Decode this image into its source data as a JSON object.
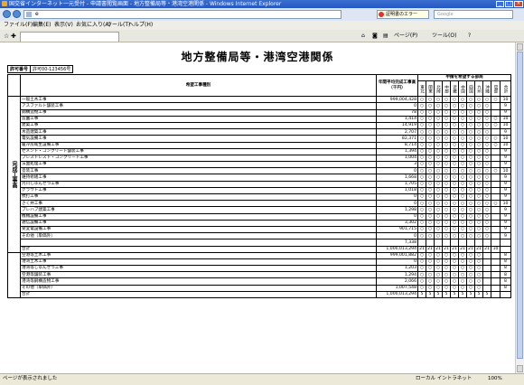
{
  "window": {
    "title": "国交省インターネット一元受付 - 申請書閲覧画面 - 地方整備局等・港湾空港関係 - Windows Internet Explorer"
  },
  "address_bar": {
    "url": "e",
    "error_label": "証明書のエラー",
    "search_placeholder": "Google"
  },
  "menu": [
    "ファイル(F)",
    "編集(E)",
    "表示(V)",
    "お気に入り(A)",
    "ツール(T)",
    "ヘルプ(H)"
  ],
  "tab": {
    "label": "",
    "toolbar_labels": [
      "ページ(P)",
      "ツール(O)"
    ]
  },
  "statusbar": {
    "text": "ページが表示されました",
    "zone": "ローカル イントラネット",
    "zoom": "100%"
  },
  "doc": {
    "title": "地方整備局等・港湾空港関係",
    "permit_label": "許可番号",
    "permit_value": "許可00-123456号",
    "col_work_type": "希望工事種別",
    "col_amount": "年間平均完成工事高（千円）",
    "col_regions_header": "申請を希望する部局",
    "regions": [
      "東北",
      "関東",
      "北陸",
      "中部",
      "近畿",
      "中国",
      "四国",
      "九州",
      "沖縄",
      "官邸",
      "合計"
    ],
    "group_completed": "完成工事高",
    "rows": [
      {
        "name": "一般土木工事",
        "amount": "999,004,428",
        "marks": "○○○○○○○○○○",
        "total": "10"
      },
      {
        "name": "アスファルト舗装工事",
        "amount": "0",
        "marks": "○○○○○○○○○",
        "total": "9"
      },
      {
        "name": "鋼構造物工事",
        "amount": "78",
        "marks": "○○○○○○○○○",
        "total": "9"
      },
      {
        "name": "造園工事",
        "amount": "1,414",
        "marks": "○○○○○○○○○○",
        "total": "10"
      },
      {
        "name": "建築工事",
        "amount": "14,919",
        "marks": "○○○○○○○○○○",
        "total": "10"
      },
      {
        "name": "木造建築工事",
        "amount": "2,707",
        "marks": "○○○○○○○○○",
        "total": "9"
      },
      {
        "name": "電気設備工事",
        "amount": "82,371",
        "marks": "○○○○○○○○○○",
        "total": "10"
      },
      {
        "name": "暖冷房衛生設備工事",
        "amount": "8,714",
        "marks": "○○○○○○○○○○",
        "total": "10"
      },
      {
        "name": "セメント・コンクリート舗装工事",
        "amount": "1,394",
        "marks": "○○○○○○○○○",
        "total": "9"
      },
      {
        "name": "プレストレスト・コンクリート工事",
        "amount": "1,004",
        "marks": "○○○○○○○○○",
        "total": "9"
      },
      {
        "name": "法面処理工事",
        "amount": "3",
        "marks": "○○○○○○○○○",
        "total": "9"
      },
      {
        "name": "塗装工事",
        "amount": "0",
        "marks": "○○○○○○○○○○",
        "total": "10"
      },
      {
        "name": "維持修繕工事",
        "amount": "1,668",
        "marks": "○○○○○○○○○",
        "total": "9"
      },
      {
        "name": "河川しゅんせつ工事",
        "amount": "1,705",
        "marks": "○○○○○○○○○",
        "total": "9"
      },
      {
        "name": "グラウト工事",
        "amount": "1,018",
        "marks": "○○○○○○○○○",
        "total": "9"
      },
      {
        "name": "杭打工事",
        "amount": "0",
        "marks": "○○○○○○○○○",
        "total": "9"
      },
      {
        "name": "さく井工事",
        "amount": "0",
        "marks": "○○○○○○○○○○",
        "total": "10"
      },
      {
        "name": "プレハブ建築工事",
        "amount": "1,298",
        "marks": "○○○○○○○○○",
        "total": "9"
      },
      {
        "name": "機械設備工事",
        "amount": "0",
        "marks": "○○○○○○○○○",
        "total": "9"
      },
      {
        "name": "通信設備工事",
        "amount": "3,302",
        "marks": "○○○○○○○○○",
        "total": "9"
      },
      {
        "name": "受変電設備工事",
        "amount": "901,715",
        "marks": "○○○○○○○○○",
        "total": "9"
      },
      {
        "name": "その他（単価外）",
        "amount": "0",
        "marks": "○○○○○○○○○",
        "total": "9"
      }
    ],
    "row_other_extra": {
      "name": "",
      "amount": "7,338"
    },
    "row_total": {
      "name": "合計",
      "amount": "1,000,013,294",
      "counts": [
        "21",
        "21",
        "21",
        "21",
        "21",
        "21",
        "21",
        "21",
        "21",
        "10"
      ]
    },
    "port_rows": [
      {
        "name": "空港等土木工事",
        "amount": "999,001,882",
        "marks": "○○○○○○○○",
        "total": "8"
      },
      {
        "name": "港湾土木工事",
        "amount": "0",
        "marks": "○○○○○○○○",
        "total": "8"
      },
      {
        "name": "港湾等しゅんせつ工事",
        "amount": "1,203",
        "marks": "○○○○○○○○",
        "total": "8"
      },
      {
        "name": "空港等舗装工事",
        "amount": "1,294",
        "marks": "○○○○○○○○",
        "total": "8"
      },
      {
        "name": "港湾等鋼構造物工事",
        "amount": "2,066",
        "marks": "○○○○○○○○",
        "total": "8"
      },
      {
        "name": "その他（単価外）",
        "amount": "1,007,548",
        "marks": "○○○○○○○○",
        "total": "8"
      }
    ],
    "row_total2": {
      "name": "合計",
      "amount": "1,000,013,294",
      "counts": [
        "5",
        "5",
        "5",
        "5",
        "5",
        "5",
        "5",
        "5",
        "5"
      ]
    }
  }
}
